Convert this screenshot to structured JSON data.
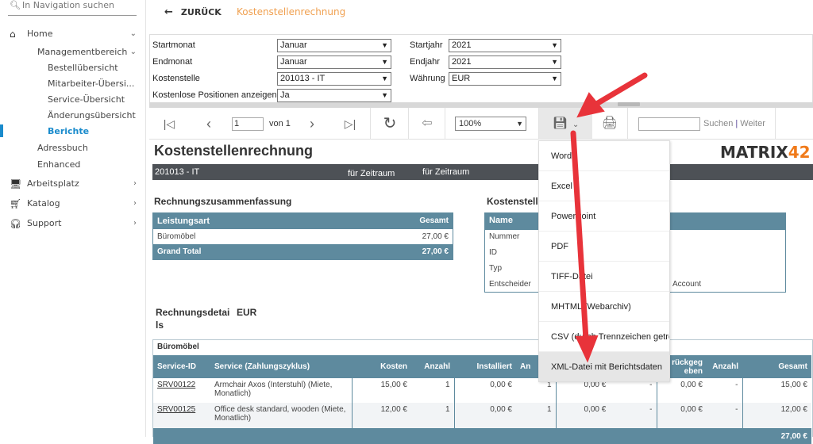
{
  "sidebar": {
    "search_placeholder": "In Navigation suchen",
    "items": [
      {
        "label": "Home",
        "icon": "home-icon",
        "expanded": true
      },
      {
        "label": "Managementbereich",
        "expanded": true
      },
      {
        "label": "Bestellübersicht"
      },
      {
        "label": "Mitarbeiter-Übersi..."
      },
      {
        "label": "Service-Übersicht"
      },
      {
        "label": "Änderungsübersicht"
      },
      {
        "label": "Berichte",
        "active": true
      },
      {
        "label": "Adressbuch"
      },
      {
        "label": "Enhanced"
      },
      {
        "label": "Arbeitsplatz",
        "icon": "workplace-icon"
      },
      {
        "label": "Katalog",
        "icon": "cart-icon"
      },
      {
        "label": "Support",
        "icon": "headset-icon"
      }
    ],
    "active_color": "#1a8bcc"
  },
  "header": {
    "back_label": "ZURÜCK",
    "title": "Kostenstellenrechnung",
    "title_color": "#f0a050"
  },
  "params": {
    "startmonat": {
      "label": "Startmonat",
      "value": "Januar"
    },
    "endmonat": {
      "label": "Endmonat",
      "value": "Januar"
    },
    "kostenstelle": {
      "label": "Kostenstelle",
      "value": "201013 - IT"
    },
    "kostenlos": {
      "label": "Kostenlose Positionen anzeigen",
      "value": "Ja"
    },
    "startjahr": {
      "label": "Startjahr",
      "value": "2021"
    },
    "endjahr": {
      "label": "Endjahr",
      "value": "2021"
    },
    "waehrung": {
      "label": "Währung",
      "value": "EUR"
    }
  },
  "toolbar": {
    "page": "1",
    "of_label": "von 1",
    "zoom": "100%",
    "search_link": "Suchen",
    "sep": "|",
    "next_link": "Weiter"
  },
  "export_menu": [
    "Word",
    "Excel",
    "PowerPoint",
    "PDF",
    "TIFF-Datei",
    "MHTML (Webarchiv)",
    "CSV (durch Trennzeichen getre",
    "XML-Datei mit Berichtsdaten"
  ],
  "report": {
    "title": "Kostenstellenrechnung",
    "logo": "MATRIX42",
    "bar": {
      "cost_center": "201013 - IT",
      "period1": "für Zeitraum",
      "period2": "für Zeitraum"
    },
    "summary": {
      "title": "Rechnungszusammenfassung",
      "headers": [
        "Leistungsart",
        "Gesamt"
      ],
      "rows": [
        [
          "Büromöbel",
          "27,00 €"
        ]
      ],
      "total": [
        "Grand Total",
        "27,00 €"
      ]
    },
    "costcenter": {
      "title": "Kostenstelle",
      "header": "Name",
      "rows": [
        "Nummer",
        "ID",
        "Typ",
        "Entscheider"
      ],
      "visible_value": "Account"
    },
    "details": {
      "title": "Rechnungsdetails",
      "currency": "EUR",
      "group": "Büromöbel",
      "headers": [
        "Service-ID",
        "Service (Zahlungszyklus)",
        "Kosten",
        "Anzahl",
        "Installiert",
        "An",
        "",
        "",
        "rückgeg eben",
        "Anzahl",
        "Gesamt"
      ],
      "rows": [
        [
          "SRV00122",
          "Armchair Axos (Interstuhl) (Miete, Monatlich)",
          "15,00 €",
          "1",
          "0,00 €",
          "1",
          "0,00 €",
          "-",
          "0,00 €",
          "-",
          "15,00 €"
        ],
        [
          "SRV00125",
          "Office desk standard, wooden (Miete, Monatlich)",
          "12,00 €",
          "1",
          "0,00 €",
          "1",
          "0,00 €",
          "-",
          "0,00 €",
          "-",
          "12,00 €"
        ]
      ],
      "total": "27,00 €"
    }
  },
  "colors": {
    "table_header": "#5e8a9e",
    "dark_bar": "#4d5156",
    "annotation_arrow": "#e8333a"
  }
}
